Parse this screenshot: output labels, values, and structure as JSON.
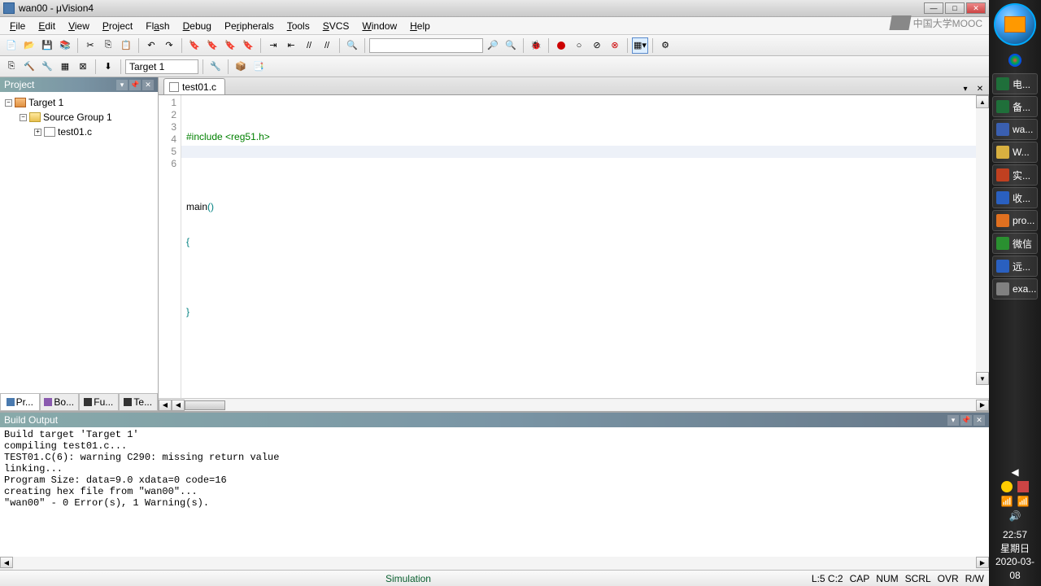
{
  "window": {
    "title": "wan00 - μVision4"
  },
  "menu": [
    "File",
    "Edit",
    "View",
    "Project",
    "Flash",
    "Debug",
    "Peripherals",
    "Tools",
    "SVCS",
    "Window",
    "Help"
  ],
  "menu_hotkeys": [
    "F",
    "E",
    "V",
    "P",
    "",
    "D",
    "",
    "T",
    "S",
    "W",
    "H"
  ],
  "watermark": "中国大学MOOC",
  "toolbar2": {
    "target": "Target 1"
  },
  "project": {
    "title": "Project",
    "root": "Target 1",
    "group": "Source Group 1",
    "file": "test01.c",
    "tabs": [
      "Pr...",
      "Bo...",
      "Fu...",
      "Te..."
    ]
  },
  "editor": {
    "tab": "test01.c",
    "lines": [
      "1",
      "2",
      "3",
      "4",
      "5",
      "6"
    ],
    "code": {
      "l1_inc": "#include ",
      "l1_hdr": "<reg51.h>",
      "l3_fn": "main",
      "l3_paren": "()",
      "l4": "{",
      "l5": "",
      "l6": "}"
    }
  },
  "build": {
    "title": "Build Output",
    "text": "Build target 'Target 1'\ncompiling test01.c...\nTEST01.C(6): warning C290: missing return value\nlinking...\nProgram Size: data=9.0 xdata=0 code=16\ncreating hex file from \"wan00\"...\n\"wan00\" - 0 Error(s), 1 Warning(s)."
  },
  "status": {
    "mode": "Simulation",
    "cursor": "L:5 C:2",
    "flags": [
      "CAP",
      "NUM",
      "SCRL",
      "OVR",
      "R/W"
    ]
  },
  "taskbar": {
    "apps": [
      {
        "label": "电...",
        "color": "#1f6f3a"
      },
      {
        "label": "备...",
        "color": "#1f6f3a"
      },
      {
        "label": "wa...",
        "color": "#3a5fb0"
      },
      {
        "label": "W...",
        "color": "#d8b040"
      },
      {
        "label": "实...",
        "color": "#c04020"
      },
      {
        "label": "收...",
        "color": "#2a60c0"
      },
      {
        "label": "pro...",
        "color": "#e07020"
      },
      {
        "label": "微信",
        "color": "#2a9030"
      },
      {
        "label": "远...",
        "color": "#2a60c0"
      },
      {
        "label": "exa...",
        "color": "#808080"
      }
    ],
    "clock": {
      "time": "22:57",
      "day": "星期日",
      "date": "2020-03-08"
    }
  }
}
